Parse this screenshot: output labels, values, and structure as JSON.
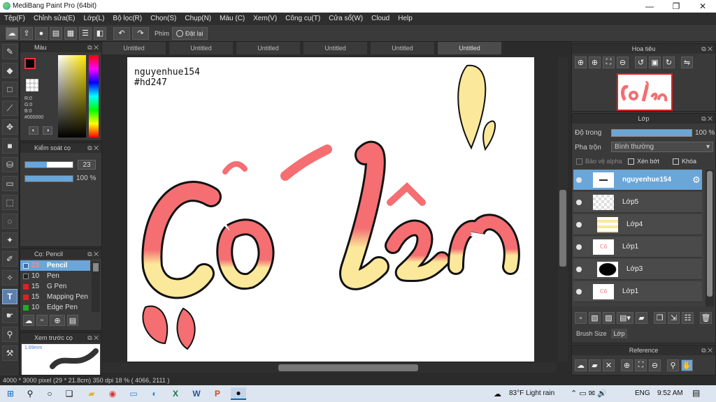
{
  "window": {
    "title": "MediBang Paint Pro (64bit)",
    "minimize": "—",
    "maximize": "❐",
    "close": "✕"
  },
  "menu": [
    "Tệp(F)",
    "Chỉnh sửa(E)",
    "Lớp(L)",
    "Bộ lọc(R)",
    "Chọn(S)",
    "Chụp(N)",
    "Màu (C)",
    "Xem(V)",
    "Công cụ(T)",
    "Cửa sổ(W)",
    "Cloud",
    "Help"
  ],
  "toolbar": {
    "phim_label": "Phím",
    "reset_label": "Đặt lại"
  },
  "color_panel": {
    "title": "Màu",
    "r": "R:0",
    "g": "G:0",
    "b": "B:0",
    "hex": "#000000"
  },
  "brush_control": {
    "title": "Kiểm soát cọ",
    "size": "23",
    "opacity": "100 %"
  },
  "brush_panel": {
    "title": "Cọ: Pencil",
    "items": [
      {
        "size": "23",
        "name": "Pencil",
        "color": "#3c6db0"
      },
      {
        "size": "10",
        "name": "Pen",
        "color": "#222222"
      },
      {
        "size": "15",
        "name": "G Pen",
        "color": "#e02020"
      },
      {
        "size": "15",
        "name": "Mapping Pen",
        "color": "#e02020"
      },
      {
        "size": "10",
        "name": "Edge Pen",
        "color": "#22aa22"
      }
    ]
  },
  "brush_preview": {
    "title": "Xem trước cọ",
    "size": "1.69mm"
  },
  "doc_tabs": [
    "Untitled",
    "Untitled",
    "Untitled",
    "Untitled",
    "Untitled",
    "Untitled"
  ],
  "canvas": {
    "author": "nguyenhue154",
    "tag": "#hd247",
    "artwork_text": "Cô lên"
  },
  "navigator": {
    "title": "Hoa tiêu"
  },
  "layer_panel": {
    "title": "Lớp",
    "opacity_label": "Độ trong",
    "opacity_value": "100 %",
    "blend_label": "Pha trộn",
    "blend_value": "Bình thường",
    "alpha_protect": "Bảo vệ alpha",
    "clipping": "Xén bớt",
    "lock": "Khóa",
    "layers": [
      {
        "name": "nguyenhue154",
        "active": true
      },
      {
        "name": "Lớp5",
        "active": false
      },
      {
        "name": "Lớp4",
        "active": false
      },
      {
        "name": "Lớp1",
        "active": false
      },
      {
        "name": "Lớp3",
        "active": false
      },
      {
        "name": "Lớp1",
        "active": false
      }
    ],
    "tab_brush_size": "Brush Size",
    "tab_layer": "Lớp"
  },
  "reference": {
    "title": "Reference"
  },
  "status": {
    "text": "4000 * 3000 pixel  (29 * 21.8cm)  350 dpi  18 %  ( 4066, 2111 )"
  },
  "taskbar": {
    "weather": "83°F  Light rain",
    "lang": "ENG",
    "time": "9:52 AM"
  },
  "colors": {
    "accent": "#6aa6d8",
    "pink": "#f46e72",
    "yellow": "#fbe89a"
  }
}
